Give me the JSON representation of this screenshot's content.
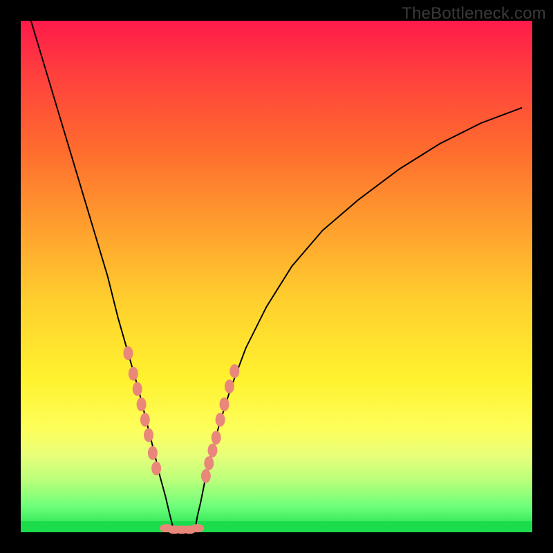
{
  "watermark": "TheBottleneck.com",
  "chart_data": {
    "type": "line",
    "title": "",
    "xlabel": "",
    "ylabel": "",
    "xlim": [
      0,
      100
    ],
    "ylim": [
      0,
      100
    ],
    "background_gradient": [
      "#ff1a4b",
      "#ff9e2e",
      "#fff22e",
      "#1bdc4a"
    ],
    "series": [
      {
        "name": "left-curve",
        "x": [
          2,
          5,
          8,
          11,
          14,
          17,
          19,
          21,
          23,
          24.5,
          26,
          27.2,
          28.3,
          29.0,
          29.5,
          30.0
        ],
        "values": [
          100,
          90,
          80,
          70,
          60,
          50,
          42,
          35,
          28,
          22,
          16,
          11,
          7,
          4,
          2,
          0
        ],
        "beads_x": [
          21.0,
          22.0,
          22.8,
          23.6,
          24.3,
          25.0,
          25.8,
          26.5
        ],
        "beads_y": [
          35,
          31,
          28,
          25,
          22,
          19,
          15.5,
          12.5
        ]
      },
      {
        "name": "right-curve",
        "x": [
          34.0,
          34.5,
          35.2,
          36.0,
          37.2,
          38.8,
          41,
          44,
          48,
          53,
          59,
          66,
          74,
          82,
          90,
          98
        ],
        "values": [
          0,
          3,
          6,
          10,
          15,
          21,
          28,
          36,
          44,
          52,
          59,
          65,
          71,
          76,
          80,
          83
        ],
        "beads_x": [
          36.2,
          36.8,
          37.5,
          38.2,
          39.0,
          39.8,
          40.8,
          41.8
        ],
        "beads_y": [
          11,
          13.5,
          16,
          18.5,
          22,
          25,
          28.5,
          31.5
        ]
      },
      {
        "name": "floor-beads",
        "x": [
          28.5,
          30.0,
          31.5,
          33.0,
          34.5
        ],
        "values": [
          0.8,
          0.5,
          0.5,
          0.5,
          0.8
        ]
      }
    ],
    "colors": {
      "curve": "#000000",
      "bead": "#e9877a",
      "floor": "#1bdc4a"
    }
  }
}
